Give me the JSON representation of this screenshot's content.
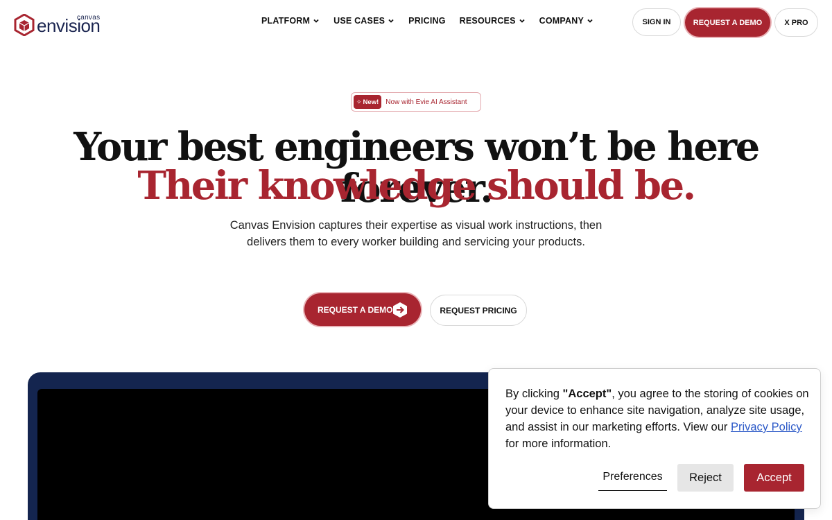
{
  "brand": {
    "small": "canvas",
    "name": "envision",
    "accent_color": "#a82530",
    "navy_color": "#1b2550"
  },
  "nav": [
    {
      "label": "PLATFORM",
      "has_dropdown": true
    },
    {
      "label": "USE CASES",
      "has_dropdown": true
    },
    {
      "label": "PRICING",
      "has_dropdown": false
    },
    {
      "label": "RESOURCES",
      "has_dropdown": true
    },
    {
      "label": "COMPANY",
      "has_dropdown": true
    }
  ],
  "header_actions": {
    "sign_in": "SIGN IN",
    "request_demo": "REQUEST A DEMO",
    "xpro": "X PRO"
  },
  "badge": {
    "tag": "New!",
    "text": "Now with Evie AI Assistant"
  },
  "hero": {
    "headline_line1": "Your best engineers won’t be here forever.",
    "headline_line2": "Their knowledge should be.",
    "subtitle": "Canvas Envision captures their expertise as visual work instructions, then delivers them to every worker building and servicing your products.",
    "cta_primary": "REQUEST A DEMO",
    "cta_secondary": "REQUEST PRICING"
  },
  "cookie": {
    "text_before": "By clicking ",
    "accept_quoted": "\"Accept\"",
    "text_after": ", you agree to the storing of cookies on your device to enhance site navigation, analyze site usage, and assist in our marketing efforts. View our ",
    "privacy_link": "Privacy Policy",
    "text_end": " for more information.",
    "preferences": "Preferences",
    "reject": "Reject",
    "accept": "Accept"
  }
}
